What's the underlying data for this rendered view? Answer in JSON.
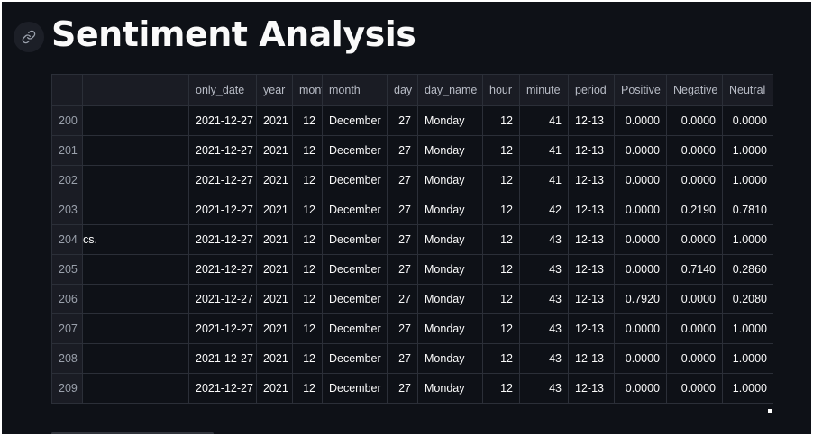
{
  "page_title": "Sentiment Analysis",
  "columns": [
    "",
    "",
    "only_date",
    "year",
    "month",
    "month",
    "day",
    "day_name",
    "hour",
    "minute",
    "period",
    "Positive",
    "Negative",
    "Neutral"
  ],
  "rows": [
    {
      "index": "200",
      "text": "",
      "only_date": "2021-12-27",
      "year": "2021",
      "mon": "12",
      "month": "December",
      "day": "27",
      "day_name": "Monday",
      "hour": "12",
      "minute": "41",
      "period": "12-13",
      "positive": "0.0000",
      "negative": "0.0000",
      "neutral": "0.0000"
    },
    {
      "index": "201",
      "text": "",
      "only_date": "2021-12-27",
      "year": "2021",
      "mon": "12",
      "month": "December",
      "day": "27",
      "day_name": "Monday",
      "hour": "12",
      "minute": "41",
      "period": "12-13",
      "positive": "0.0000",
      "negative": "0.0000",
      "neutral": "1.0000"
    },
    {
      "index": "202",
      "text": "",
      "only_date": "2021-12-27",
      "year": "2021",
      "mon": "12",
      "month": "December",
      "day": "27",
      "day_name": "Monday",
      "hour": "12",
      "minute": "41",
      "period": "12-13",
      "positive": "0.0000",
      "negative": "0.0000",
      "neutral": "1.0000"
    },
    {
      "index": "203",
      "text": "",
      "only_date": "2021-12-27",
      "year": "2021",
      "mon": "12",
      "month": "December",
      "day": "27",
      "day_name": "Monday",
      "hour": "12",
      "minute": "42",
      "period": "12-13",
      "positive": "0.0000",
      "negative": "0.2190",
      "neutral": "0.7810"
    },
    {
      "index": "204",
      "text": "cs.",
      "only_date": "2021-12-27",
      "year": "2021",
      "mon": "12",
      "month": "December",
      "day": "27",
      "day_name": "Monday",
      "hour": "12",
      "minute": "43",
      "period": "12-13",
      "positive": "0.0000",
      "negative": "0.0000",
      "neutral": "1.0000"
    },
    {
      "index": "205",
      "text": "",
      "only_date": "2021-12-27",
      "year": "2021",
      "mon": "12",
      "month": "December",
      "day": "27",
      "day_name": "Monday",
      "hour": "12",
      "minute": "43",
      "period": "12-13",
      "positive": "0.0000",
      "negative": "0.7140",
      "neutral": "0.2860"
    },
    {
      "index": "206",
      "text": "",
      "only_date": "2021-12-27",
      "year": "2021",
      "mon": "12",
      "month": "December",
      "day": "27",
      "day_name": "Monday",
      "hour": "12",
      "minute": "43",
      "period": "12-13",
      "positive": "0.7920",
      "negative": "0.0000",
      "neutral": "0.2080"
    },
    {
      "index": "207",
      "text": "",
      "only_date": "2021-12-27",
      "year": "2021",
      "mon": "12",
      "month": "December",
      "day": "27",
      "day_name": "Monday",
      "hour": "12",
      "minute": "43",
      "period": "12-13",
      "positive": "0.0000",
      "negative": "0.0000",
      "neutral": "1.0000"
    },
    {
      "index": "208",
      "text": "",
      "only_date": "2021-12-27",
      "year": "2021",
      "mon": "12",
      "month": "December",
      "day": "27",
      "day_name": "Monday",
      "hour": "12",
      "minute": "43",
      "period": "12-13",
      "positive": "0.0000",
      "negative": "0.0000",
      "neutral": "1.0000"
    },
    {
      "index": "209",
      "text": "",
      "only_date": "2021-12-27",
      "year": "2021",
      "mon": "12",
      "month": "December",
      "day": "27",
      "day_name": "Monday",
      "hour": "12",
      "minute": "43",
      "period": "12-13",
      "positive": "0.0000",
      "negative": "0.0000",
      "neutral": "1.0000"
    }
  ],
  "icons": {
    "anchor": "link-icon"
  },
  "colors": {
    "background": "#0e1117",
    "header_bg": "#1a1c24",
    "text": "#fafafa",
    "grid": "#2b2f38"
  }
}
